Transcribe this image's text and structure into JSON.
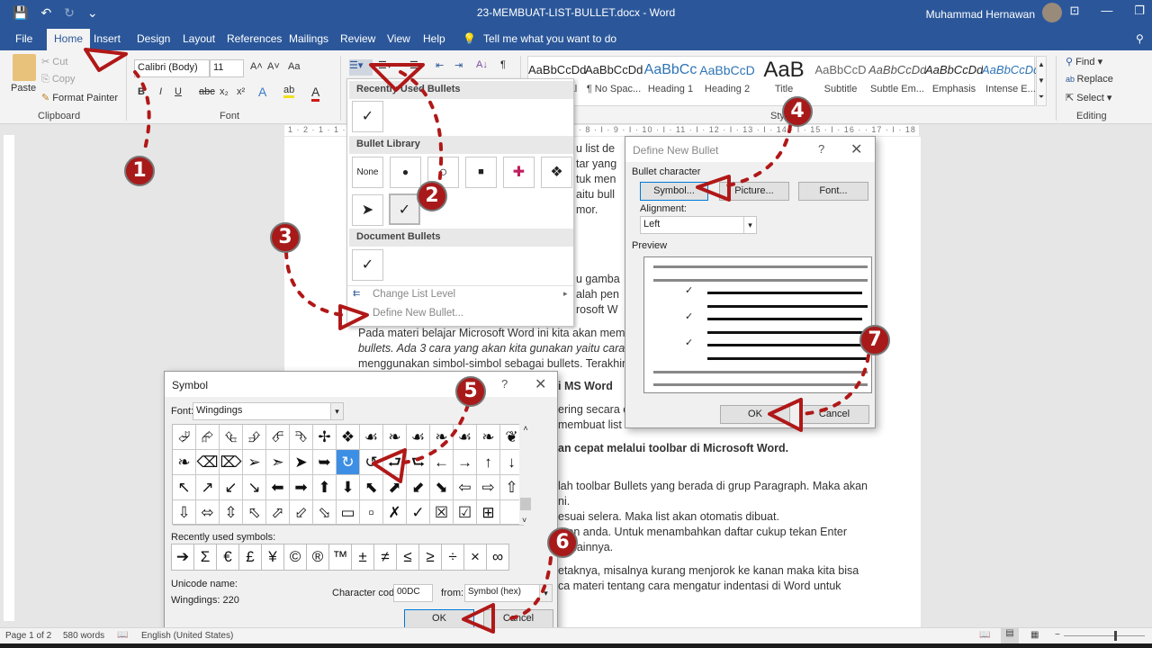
{
  "titlebar": {
    "doc_title": "23-MEMBUAT-LIST-BULLET.docx  -  Word",
    "user_name": "Muhammad Hernawan",
    "qat": {
      "save_icon": "💾",
      "undo_icon": "↶",
      "redo_icon": "↻",
      "customize_icon": "⌄"
    },
    "window_buttons": {
      "ribbon_display": "⊡",
      "minimize": "—",
      "restore": "❐"
    }
  },
  "tabs": {
    "file": "File",
    "home": "Home",
    "insert": "Insert",
    "design": "Design",
    "layout": "Layout",
    "references": "References",
    "mailings": "Mailings",
    "review": "Review",
    "view": "View",
    "help": "Help",
    "tell_me": "Tell me what you want to do"
  },
  "clipboard": {
    "paste": "Paste",
    "cut": "Cut",
    "copy": "Copy",
    "format_painter": "Format Painter",
    "group_label": "Clipboard"
  },
  "font": {
    "font_name": "Calibri (Body)",
    "font_size": "11",
    "grow": "A˄",
    "shrink": "A˅",
    "change_case": "Aa",
    "bold": "B",
    "italic": "I",
    "underline": "U",
    "strikethrough": "abc",
    "subscript": "x₂",
    "superscript": "x²",
    "text_effects": "A",
    "highlight": "ab",
    "font_color": "A",
    "group_label": "Font"
  },
  "paragraph": {
    "sort_icon": "A↓",
    "show_marks": "¶"
  },
  "styles": {
    "group_label": "Styles",
    "items": [
      {
        "sample": "AaBbCcDd",
        "name": "¶ Normal"
      },
      {
        "sample": "AaBbCcDd",
        "name": "¶ No Spac..."
      },
      {
        "sample": "AaBbCc",
        "name": "Heading 1"
      },
      {
        "sample": "AaBbCcD",
        "name": "Heading 2"
      },
      {
        "sample": "AaB",
        "name": "Title"
      },
      {
        "sample": "AaBbCcD",
        "name": "Subtitle"
      },
      {
        "sample": "AaBbCcDd",
        "name": "Subtle Em..."
      },
      {
        "sample": "AaBbCcDd",
        "name": "Emphasis"
      },
      {
        "sample": "AaBbCcDd",
        "name": "Intense E..."
      }
    ]
  },
  "editing": {
    "find": "Find",
    "replace": "Replace",
    "select": "Select",
    "group_label": "Editing"
  },
  "ruler": {
    "top": "1 · 2 · 1 · 1 ·  ·  ·  ·  ·  ·  ·  ·  ·  ·  ·  ·  ·  ·  ·  ·  ·  ·  ·  ·  ·  ·  ·  ·  ·  ·  ·  ·  ·  ·  ·  ·  ·  ·  ·  ·  8 · I · 9 · I · 10 · I · 11 · I · 12 · I · 13 · I · 14 · I · 15 · I · 16 ·  · 17 · I · 18 · I"
  },
  "document": {
    "lines": [
      "u list de",
      "tar yang",
      "tuk men",
      "aitu bull",
      "mor.",
      "u gamba",
      "alah pen",
      "rosoft W",
      "Pada materi belajar Microsoft Word ini kita akan membal",
      "bullets. Ada 3 cara yang akan kita gunakan yaitu cara cep",
      "menggunakan simbol-simbol sebagai bullets. Terakhir, ca",
      "i MS Word",
      "ering secara ce",
      "membuat list c",
      "an cepat melalui toolbar di Microsoft Word.",
      "lah toolbar Bullets yang berada di grup Paragraph. Maka akan",
      "ni.",
      "esuai selera. Maka list akan otomatis dibuat.",
      "men anda. Untuk menambahkan daftar cukup tekan Enter",
      "tar lainnya.",
      "etaknya, misalnya kurang menjorok ke kanan maka kita bisa",
      "ca materi tentang cara mengatur indentasi di Word untuk"
    ]
  },
  "bullets_menu": {
    "recently_used_header": "Recently Used Bullets",
    "recently_used": [
      "✓"
    ],
    "library_header": "Bullet Library",
    "library": [
      "None",
      "●",
      "○",
      "■",
      "✚",
      "❖",
      "➤",
      "✓"
    ],
    "document_header": "Document Bullets",
    "document_bullets": [
      "✓"
    ],
    "change_list_level": "Change List Level",
    "define_new_bullet": "Define New Bullet..."
  },
  "define_bullet_dialog": {
    "title": "Define New Bullet",
    "help": "?",
    "close": "✕",
    "bullet_character_label": "Bullet character",
    "symbol_button": "Symbol...",
    "picture_button": "Picture...",
    "font_button": "Font...",
    "alignment_label": "Alignment:",
    "alignment_value": "Left",
    "preview_label": "Preview",
    "preview_bullet": "✓",
    "ok": "OK",
    "cancel": "Cancel"
  },
  "symbol_dialog": {
    "title": "Symbol",
    "help": "?",
    "close": "✕",
    "font_label": "Font:",
    "font_value": "Wingdings",
    "grid": [
      "⮰",
      "⮳",
      "⮴",
      "⮵",
      "⮶",
      "⮷",
      "✢",
      "❖",
      "☙",
      "❧",
      "☙",
      "❧",
      "☙",
      "❧",
      "❦",
      "❧",
      "⌫",
      "⌦",
      "➢",
      "➣",
      "➤",
      "➥",
      "↻",
      "↺",
      "⮐",
      "⮑",
      "←",
      "→",
      "↑",
      "↓",
      "↖",
      "↗",
      "↙",
      "↘",
      "⬅",
      "➡",
      "⬆",
      "⬇",
      "⬉",
      "⬈",
      "⬋",
      "⬊",
      "⇦",
      "⇨",
      "⇧",
      "⇩",
      "⬄",
      "⇳",
      "⬁",
      "⬀",
      "⬃",
      "⬂",
      "▭",
      "▫",
      "✗",
      "✓",
      "☒",
      "☑",
      "⊞",
      ""
    ],
    "selected_index": 22,
    "recently_used_label": "Recently used symbols:",
    "recently_used": [
      "➔",
      "Σ",
      "€",
      "£",
      "¥",
      "©",
      "®",
      "™",
      "±",
      "≠",
      "≤",
      "≥",
      "÷",
      "×",
      "∞"
    ],
    "unicode_name_label": "Unicode name:",
    "unicode_name_value": "Wingdings: 220",
    "character_code_label": "Character code:",
    "character_code_value": "00DC",
    "from_label": "from:",
    "from_value": "Symbol (hex)",
    "ok": "OK",
    "cancel": "Cancel"
  },
  "statusbar": {
    "page": "Page 1 of 2",
    "words": "580 words",
    "language": "English (United States)"
  },
  "annotations": [
    "1",
    "2",
    "3",
    "4",
    "5",
    "6",
    "7"
  ],
  "colors": {
    "accent": "#2b579a",
    "annotation": "#a81a1a",
    "selected_symbol": "#3d8ee5"
  }
}
